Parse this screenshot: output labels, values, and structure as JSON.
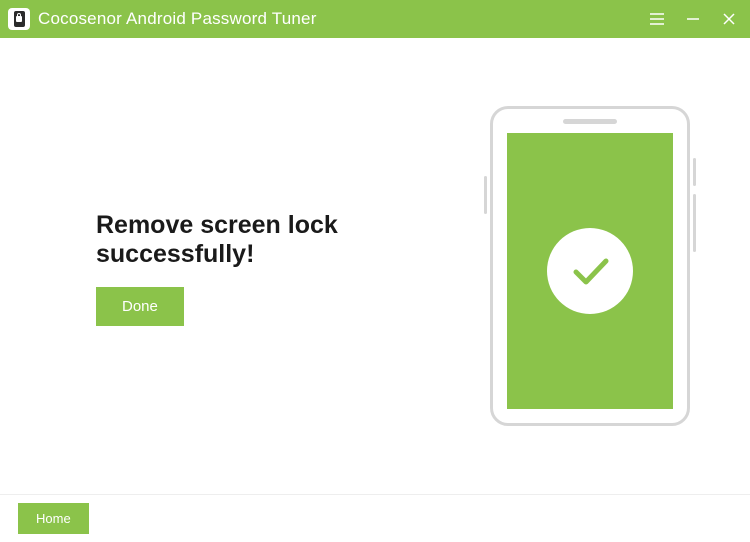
{
  "titlebar": {
    "app_title": "Cocosenor Android Password Tuner"
  },
  "main": {
    "heading": "Remove screen lock successfully!",
    "done_label": "Done"
  },
  "footer": {
    "home_label": "Home"
  },
  "colors": {
    "accent": "#8bc34a"
  }
}
